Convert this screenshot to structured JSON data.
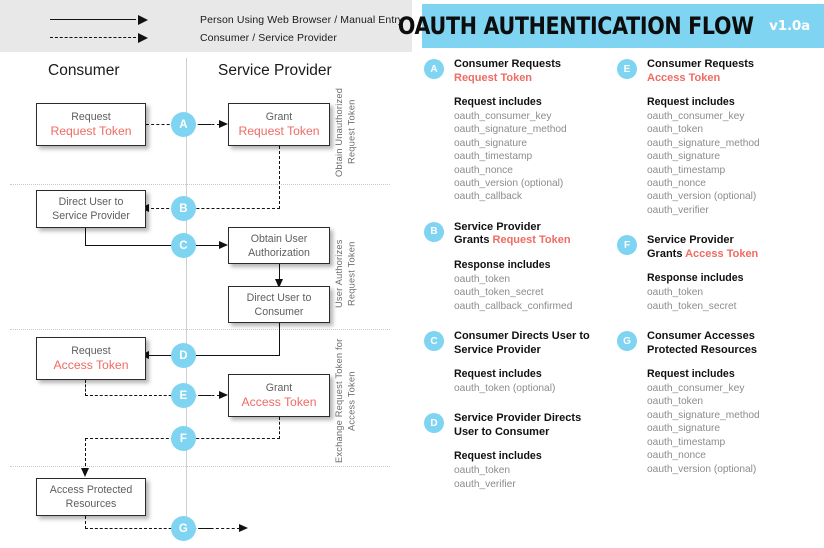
{
  "legend": {
    "rows": [
      {
        "style": "solid",
        "label": "Person Using Web Browser / Manual Entry"
      },
      {
        "style": "dashed",
        "label": "Consumer / Service Provider"
      }
    ]
  },
  "diagram": {
    "columns": {
      "consumer": "Consumer",
      "service_provider": "Service Provider"
    },
    "phases": [
      {
        "id": "phase-1",
        "label": "Obtain Unauthorized\nRequest Token"
      },
      {
        "id": "phase-2",
        "label": "User Authorizes\nRequest Token"
      },
      {
        "id": "phase-3",
        "label": "Exchange Request Token\nfor Access Token"
      }
    ],
    "nodes": [
      {
        "id": "n-request-request-token",
        "line1": "Request",
        "line2": "Request Token"
      },
      {
        "id": "n-grant-request-token",
        "line1": "Grant",
        "line2": "Request Token"
      },
      {
        "id": "n-direct-user-to-sp",
        "line1": "Direct User to\nService Provider",
        "line2": ""
      },
      {
        "id": "n-obtain-user-auth",
        "line1": "Obtain User\nAuthorization",
        "line2": ""
      },
      {
        "id": "n-direct-user-to-consumer",
        "line1": "Direct User to\nConsumer",
        "line2": ""
      },
      {
        "id": "n-request-access-token",
        "line1": "Request",
        "line2": "Access Token"
      },
      {
        "id": "n-grant-access-token",
        "line1": "Grant",
        "line2": "Access Token"
      },
      {
        "id": "n-access-protected",
        "line1": "Access Protected\nResources",
        "line2": ""
      }
    ],
    "steps": [
      {
        "id": "A",
        "label": "A",
        "arrow": "dashed"
      },
      {
        "id": "B",
        "label": "B",
        "arrow": "dashed"
      },
      {
        "id": "C",
        "label": "C",
        "arrow": "solid"
      },
      {
        "id": "D",
        "label": "D",
        "arrow": "solid"
      },
      {
        "id": "E",
        "label": "E",
        "arrow": "dashed"
      },
      {
        "id": "F",
        "label": "F",
        "arrow": "dashed"
      },
      {
        "id": "G",
        "label": "G",
        "arrow": "dashed"
      }
    ]
  },
  "header": {
    "title": "OAUTH AUTHENTICATION FLOW",
    "version": "v1.0a",
    "accent_color": "#7fd4f2",
    "token_color": "#ef6b63"
  },
  "spec": {
    "left_column": [
      {
        "badge": "A",
        "title_plain": "Consumer Requests",
        "title_accent": "Request Token",
        "subhead": "Request includes",
        "items": [
          "oauth_consumer_key",
          "oauth_signature_method",
          "oauth_signature",
          "oauth_timestamp",
          "oauth_nonce",
          "oauth_version (optional)",
          "oauth_callback"
        ]
      },
      {
        "badge": "B",
        "title_plain": "Service Provider\nGrants ",
        "title_accent": "Request Token",
        "subhead": "Response includes",
        "items": [
          "oauth_token",
          "oauth_token_secret",
          "oauth_callback_confirmed"
        ]
      },
      {
        "badge": "C",
        "title_plain": "Consumer Directs User to\nService Provider",
        "title_accent": "",
        "subhead": "Request includes",
        "items": [
          "oauth_token (optional)"
        ]
      },
      {
        "badge": "D",
        "title_plain": "Service Provider Directs\nUser to Consumer",
        "title_accent": "",
        "subhead": "Request includes",
        "items": [
          "oauth_token",
          "oauth_verifier"
        ]
      }
    ],
    "right_column": [
      {
        "badge": "E",
        "title_plain": "Consumer Requests",
        "title_accent": "Access Token",
        "subhead": "Request includes",
        "items": [
          "oauth_consumer_key",
          "oauth_token",
          "oauth_signature_method",
          "oauth_signature",
          "oauth_timestamp",
          "oauth_nonce",
          "oauth_version (optional)",
          "oauth_verifier"
        ]
      },
      {
        "badge": "F",
        "title_plain": "Service Provider\nGrants ",
        "title_accent": "Access Token",
        "subhead": "Response includes",
        "items": [
          "oauth_token",
          "oauth_token_secret"
        ]
      },
      {
        "badge": "G",
        "title_plain": "Consumer Accesses\nProtected Resources",
        "title_accent": "",
        "subhead": "Request includes",
        "items": [
          "oauth_consumer_key",
          "oauth_token",
          "oauth_signature_method",
          "oauth_signature",
          "oauth_timestamp",
          "oauth_nonce",
          "oauth_version (optional)"
        ]
      }
    ]
  }
}
